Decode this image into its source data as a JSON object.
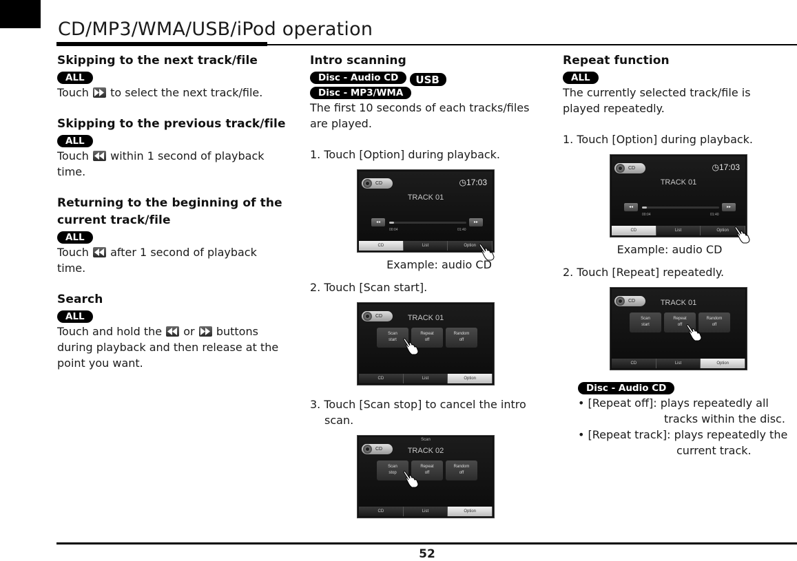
{
  "header": {
    "title": "CD/MP3/WMA/USB/iPod operation"
  },
  "footer": {
    "page_number": "52"
  },
  "column1": {
    "sections": [
      {
        "heading": "Skipping to the next track/file",
        "badge": "ALL",
        "text_before": "Touch",
        "icon": "fast-forward-icon",
        "text_after": "to select the next track/file."
      },
      {
        "heading": "Skipping to the previous track/file",
        "badge": "ALL",
        "text_before": "Touch",
        "icon": "rewind-icon",
        "text_after": "within 1 second of playback",
        "text_line2": "time."
      },
      {
        "heading_line1": "Returning to the beginning of the",
        "heading_line2": "current track/file",
        "badge": "ALL",
        "text_before": "Touch",
        "icon": "rewind-icon",
        "text_after": "after 1 second of playback",
        "text_line2": "time."
      },
      {
        "heading": "Search",
        "badge": "ALL",
        "text_before": "Touch and hold the",
        "icon1": "rewind-icon",
        "text_mid": "or",
        "icon2": "fast-forward-icon",
        "text_after": "buttons",
        "text_line2": "during playback and then release at the",
        "text_line3": "point you want."
      }
    ]
  },
  "column2": {
    "heading": "Intro scanning",
    "badges": [
      "Disc - Audio CD",
      "USB",
      "Disc - MP3/WMA"
    ],
    "intro_line1": "The first 10 seconds of each tracks/files",
    "intro_line2": "are played.",
    "steps": [
      {
        "line1": "1. Touch [Option] during playback."
      },
      {
        "line1": "2. Touch [Scan start]."
      },
      {
        "line1": "3. Touch [Scan stop] to cancel the intro",
        "line2": "scan."
      }
    ],
    "caption": "Example: audio CD",
    "screens": {
      "playback": {
        "source": "CD",
        "clock": "17:03",
        "track": "TRACK 01",
        "elapsed": "00:04",
        "total": "01:40",
        "progress": 0.04,
        "rew": "◂◂",
        "ff": "▸▸",
        "tabs": [
          "CD",
          "List",
          "Option"
        ],
        "active_tab": "CD"
      },
      "scan_start": {
        "source": "CD",
        "track": "TRACK 01",
        "options": [
          [
            "Scan",
            "start"
          ],
          [
            "Repeat",
            "off"
          ],
          [
            "Random",
            "off"
          ]
        ],
        "tabs": [
          "CD",
          "List",
          "Option"
        ],
        "active_tab": "Option"
      },
      "scan_stop": {
        "header": "Scan",
        "source": "CD",
        "track": "TRACK 02",
        "options": [
          [
            "Scan",
            "stop"
          ],
          [
            "Repeat",
            "off"
          ],
          [
            "Random",
            "off"
          ]
        ],
        "tabs": [
          "CD",
          "List",
          "Option"
        ],
        "active_tab": "Option"
      }
    }
  },
  "column3": {
    "heading": "Repeat function",
    "badge": "ALL",
    "intro_line1": "The currently selected track/file is",
    "intro_line2": "played repeatedly.",
    "steps": [
      {
        "line1": "1.  Touch [Option] during playback."
      },
      {
        "line1": "2. Touch [Repeat] repeatedly."
      }
    ],
    "caption": "Example: audio CD",
    "screens": {
      "playback": {
        "source": "CD",
        "clock": "17:03",
        "track": "TRACK 01",
        "elapsed": "00:04",
        "total": "01:40",
        "progress": 0.04,
        "rew": "◂◂",
        "ff": "▸▸",
        "tabs": [
          "CD",
          "List",
          "Option"
        ],
        "active_tab": "CD"
      },
      "repeat": {
        "source": "CD",
        "track": "TRACK 01",
        "options": [
          [
            "Scan",
            "start"
          ],
          [
            "Repeat",
            "off"
          ],
          [
            "Random",
            "off"
          ]
        ],
        "tabs": [
          "CD",
          "List",
          "Option"
        ],
        "active_tab": "Option"
      }
    },
    "note_badge": "Disc - Audio CD",
    "notes": [
      {
        "label": "• [Repeat off]: plays repeatedly all",
        "cont": "tracks within the disc."
      },
      {
        "label": "• [Repeat track]: plays repeatedly the",
        "cont": "current track."
      }
    ]
  }
}
